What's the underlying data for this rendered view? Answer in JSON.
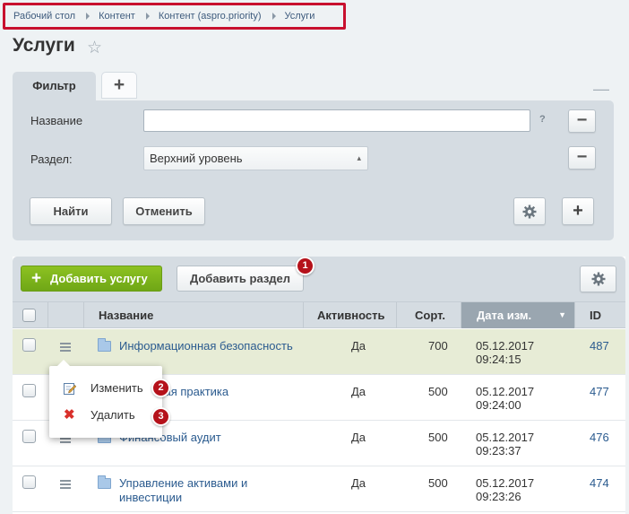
{
  "breadcrumb": [
    "Рабочий стол",
    "Контент",
    "Контент (aspro.priority)",
    "Услуги"
  ],
  "page": {
    "title": "Услуги"
  },
  "filter": {
    "tab_label": "Фильтр",
    "name_label": "Название",
    "name_value": "",
    "help": "?",
    "section_label": "Раздел:",
    "section_value": "Верхний уровень",
    "find_label": "Найти",
    "cancel_label": "Отменить"
  },
  "toolbar": {
    "add_service_label": "Добавить услугу",
    "add_section_label": "Добавить раздел"
  },
  "badges": [
    "1",
    "2",
    "3"
  ],
  "table": {
    "headers": {
      "name": "Название",
      "active": "Активность",
      "sort": "Сорт.",
      "date": "Дата изм.",
      "id": "ID"
    },
    "rows": [
      {
        "name": "Информационная безопасность",
        "active": "Да",
        "sort": "700",
        "date": "05.12.2017",
        "time": "09:24:15",
        "id": "487"
      },
      {
        "name": "ская практика",
        "active": "Да",
        "sort": "500",
        "date": "05.12.2017",
        "time": "09:24:00",
        "id": "477"
      },
      {
        "name": "Финансовый аудит",
        "active": "Да",
        "sort": "500",
        "date": "05.12.2017",
        "time": "09:23:37",
        "id": "476"
      },
      {
        "name": "Управление активами и инвестиции",
        "active": "Да",
        "sort": "500",
        "date": "05.12.2017",
        "time": "09:23:26",
        "id": "474"
      }
    ]
  },
  "context_menu": {
    "edit_label": "Изменить",
    "delete_label": "Удалить"
  },
  "colors": {
    "accent_green": "#7cb61a",
    "link": "#2b5b8f",
    "badge": "#b5121b",
    "highlight_row": "#e7ecd6"
  }
}
